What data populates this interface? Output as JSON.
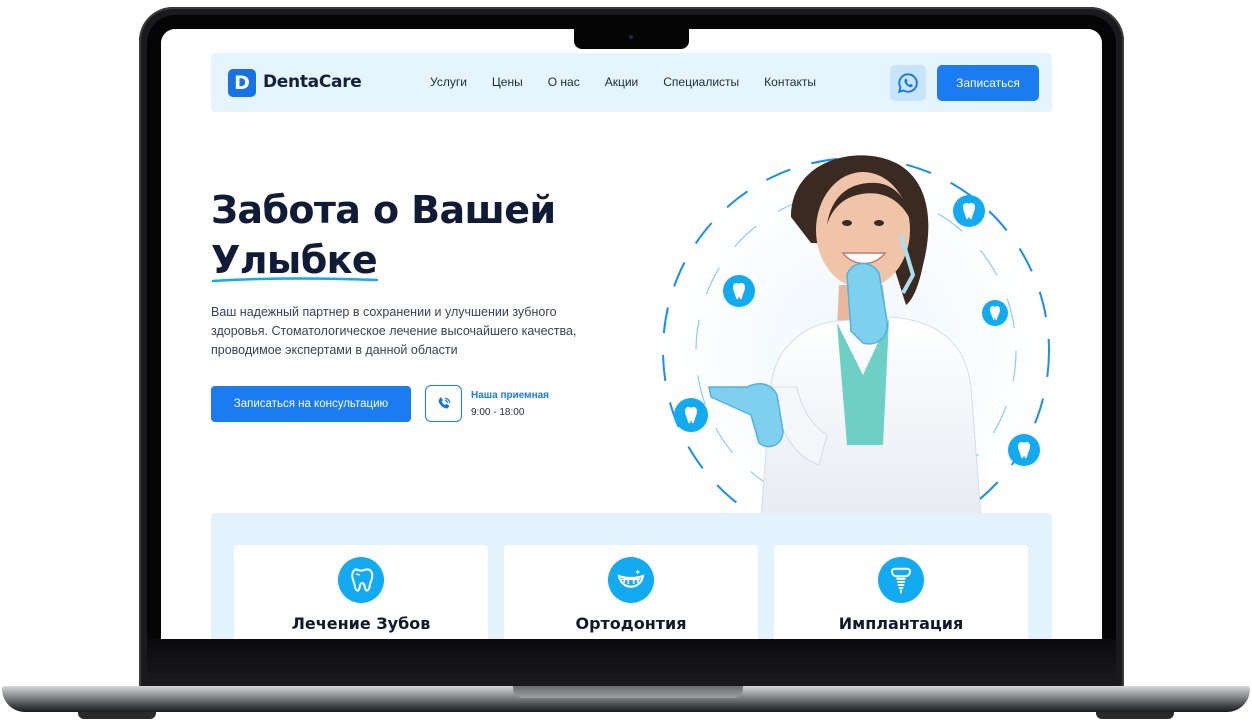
{
  "brand": {
    "name": "DentaCare",
    "mark": "D",
    "accent": "#1a7cf0",
    "icon_color": "#12aaf0",
    "dark": "#101b36"
  },
  "nav": {
    "links": [
      "Услуги",
      "Цены",
      "О нас",
      "Акции",
      "Специалисты",
      "Контакты"
    ],
    "whatsapp_icon": "whatsapp-icon",
    "cta_label": "Записаться"
  },
  "hero": {
    "title_line1": "Забота о Вашей",
    "title_line2": "Улыбке",
    "description": "Ваш надежный партнер в сохранении и улучшении зубного здоровья. Стоматологическое лечение высочайшего качества, проводимое экспертами в данной области",
    "consult_label": "Записаться на консультацию",
    "reception_label": "Наша приемная",
    "reception_hours": "9:00 - 18:00",
    "phone_icon": "phone-icon",
    "badge_icon": "tooth-icon"
  },
  "services": [
    {
      "title": "Лечение Зубов",
      "icon": "tooth-icon"
    },
    {
      "title": "Ортодонтия",
      "icon": "smile-braces-icon"
    },
    {
      "title": "Имплантация",
      "icon": "implant-icon"
    }
  ]
}
